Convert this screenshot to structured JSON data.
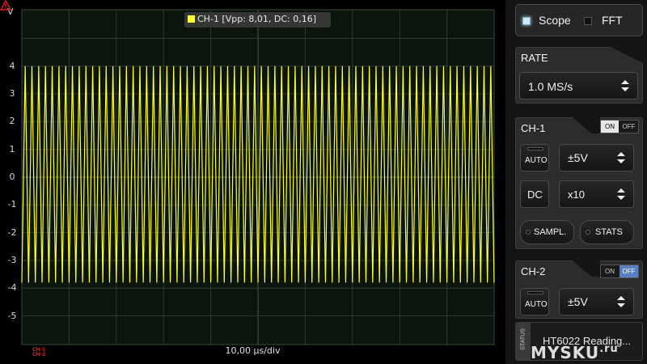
{
  "scope": {
    "y_unit": "V",
    "y_ticks": [
      "4",
      "3",
      "2",
      "1",
      "0",
      "-1",
      "-2",
      "-3",
      "-4",
      "-5"
    ],
    "channel_info": "CH-1 [Vpp: 8,01, DC: 0,16]",
    "channel_color": "#ffff3c",
    "time_div": "10,00 µs/div",
    "warning_channels": [
      "CH-1",
      "CH-2"
    ],
    "warning_color": "#e02020",
    "grid_color": "#2e3a2e",
    "cycles_visible": 70,
    "signal_high_v": 4.0,
    "signal_low_v": -3.8
  },
  "mode": {
    "scope_label": "Scope",
    "fft_label": "FFT",
    "active": "Scope"
  },
  "rate": {
    "title": "RATE",
    "value": "1.0 MS/s"
  },
  "ch1": {
    "title": "CH-1",
    "on_label": "ON",
    "off_label": "OFF",
    "state": "ON",
    "auto_label": "AUTO",
    "range": "±5V",
    "coupling": "DC",
    "probe": "x10",
    "sample_label": "SAMPL.",
    "stats_label": "STATS"
  },
  "ch2": {
    "title": "CH-2",
    "on_label": "ON",
    "off_label": "OFF",
    "state": "OFF",
    "auto_label": "AUTO",
    "range": "±5V"
  },
  "status": {
    "label": "STATUS",
    "text": "HT6022 Reading...",
    "watermark": "MYSKU",
    "watermark_suffix": ".ru"
  }
}
